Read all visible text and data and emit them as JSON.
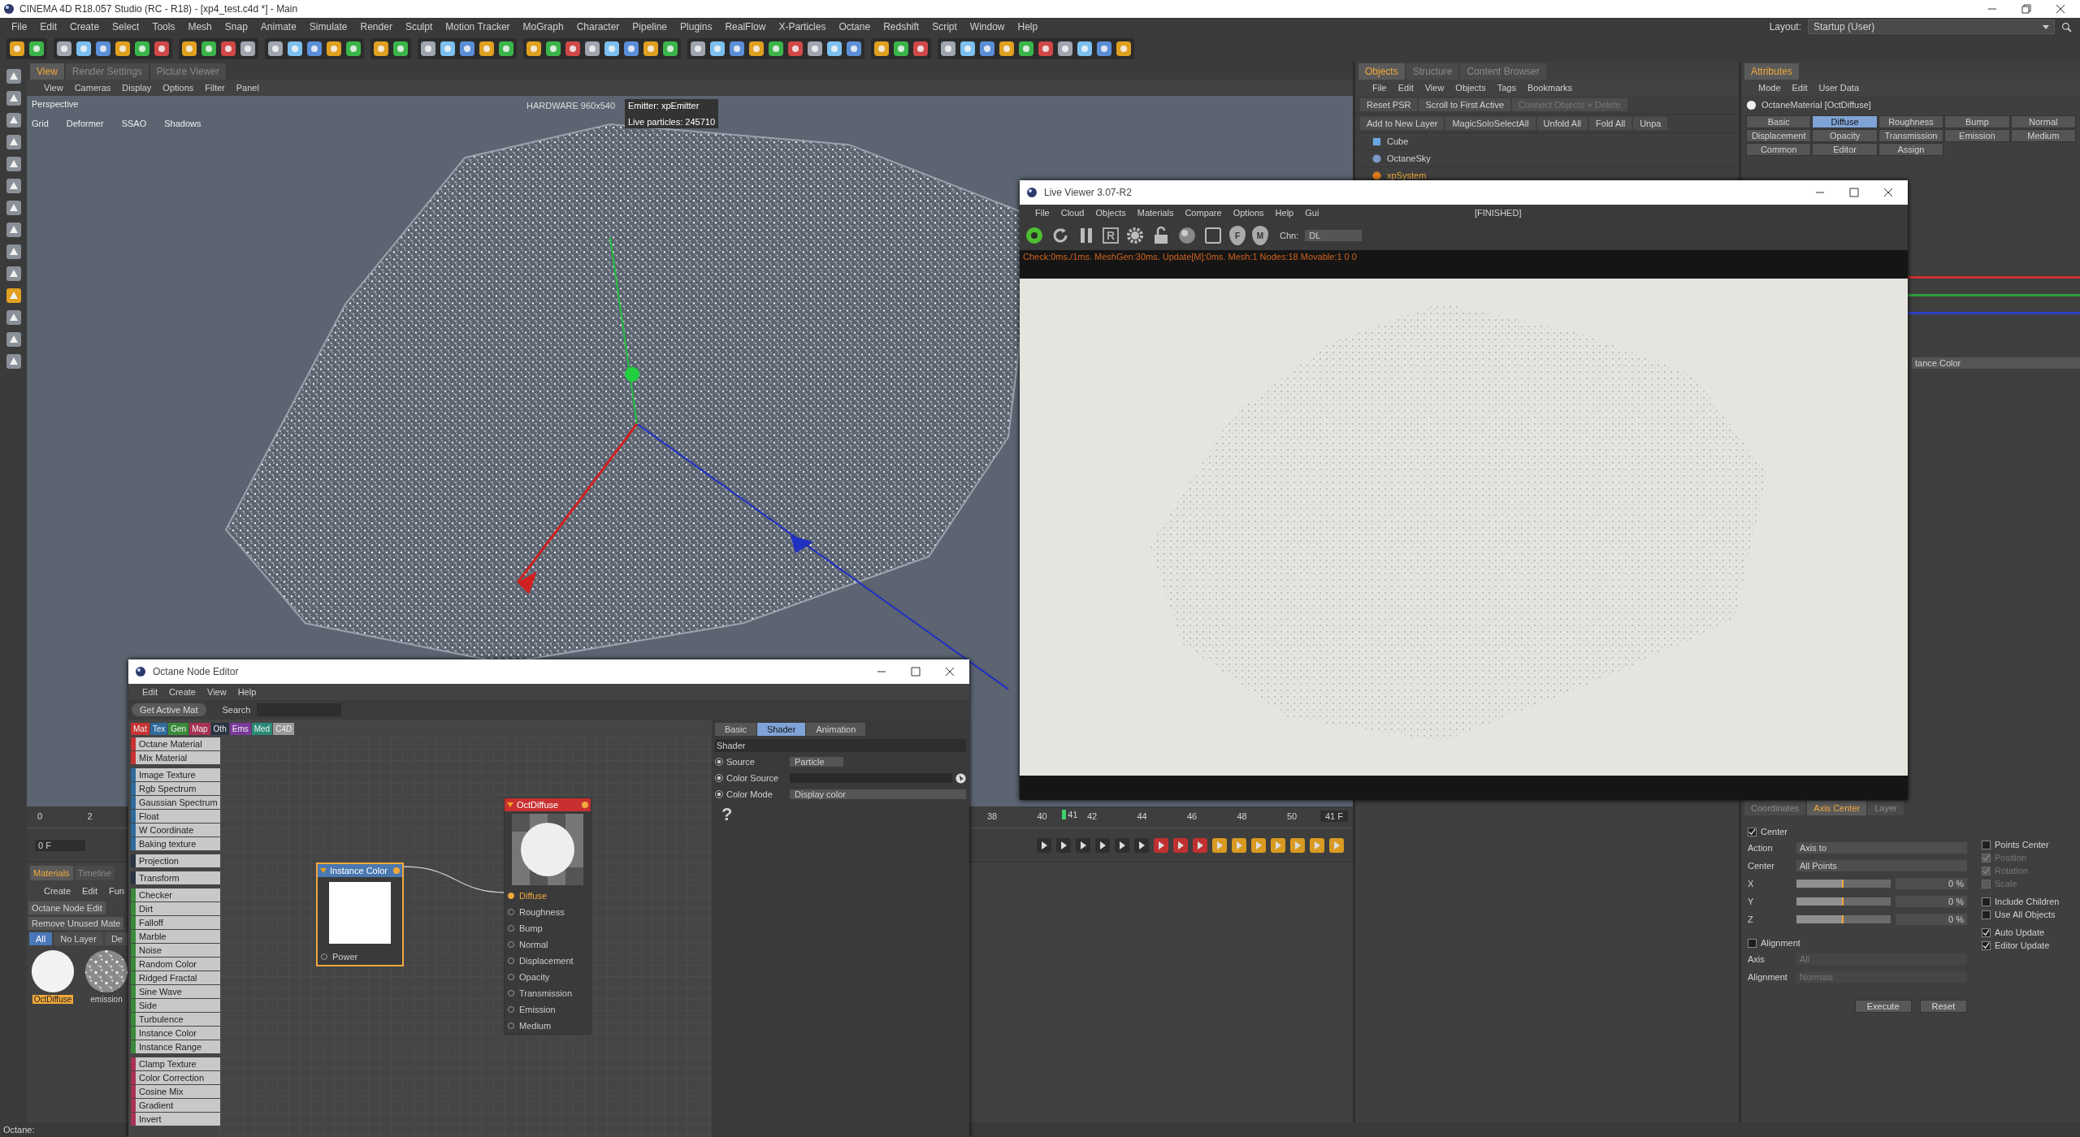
{
  "window": {
    "title": "CINEMA 4D R18.057 Studio (RC - R18) - [xp4_test.c4d *] - Main"
  },
  "menu": [
    "File",
    "Edit",
    "Create",
    "Select",
    "Tools",
    "Mesh",
    "Snap",
    "Animate",
    "Simulate",
    "Render",
    "Sculpt",
    "Motion Tracker",
    "MoGraph",
    "Character",
    "Pipeline",
    "Plugins",
    "RealFlow",
    "X-Particles",
    "Octane",
    "Redshift",
    "Script",
    "Window",
    "Help"
  ],
  "layout": {
    "label": "Layout:",
    "value": "Startup (User)"
  },
  "viewport": {
    "tabs": [
      {
        "label": "View",
        "selected": true
      },
      {
        "label": "Render Settings",
        "selected": false
      },
      {
        "label": "Picture Viewer",
        "selected": false
      }
    ],
    "menu": [
      "View",
      "Cameras",
      "Display",
      "Options",
      "Filter",
      "Panel"
    ],
    "camera": "Perspective",
    "overlays": [
      "Grid",
      "Deformer",
      "SSAO",
      "Shadows"
    ],
    "hud_left": "HARDWARE 960x540",
    "hud_right": [
      "Emitter: xpEmitter",
      "Live particles: 245710"
    ]
  },
  "timeline": {
    "ticks": [
      "0",
      "2",
      "38",
      "40",
      "42",
      "44",
      "46",
      "48",
      "50"
    ],
    "current": "41",
    "start_field": "0 F",
    "end_field": "41 F"
  },
  "materials": {
    "tabs": [
      {
        "label": "Materials",
        "selected": true
      },
      {
        "label": "Timeline",
        "selected": false
      }
    ],
    "menu": [
      "Create",
      "Edit",
      "Fun"
    ],
    "commands": [
      "Octane Node Edit",
      "Remove Unused Mate"
    ],
    "filters": [
      {
        "label": "All",
        "selected": true
      },
      {
        "label": "No Layer",
        "selected": false
      },
      {
        "label": "De",
        "selected": false
      }
    ],
    "swatches": [
      {
        "name": "OctDiffuse",
        "selected": true,
        "kind": "smooth"
      },
      {
        "name": "emission",
        "selected": false,
        "kind": "noisy"
      }
    ]
  },
  "objects": {
    "tabs": [
      {
        "label": "Objects",
        "selected": true
      },
      {
        "label": "Structure",
        "selected": false
      },
      {
        "label": "Content Browser",
        "selected": false
      }
    ],
    "menu": [
      "File",
      "Edit",
      "View",
      "Objects",
      "Tags",
      "Bookmarks"
    ],
    "toolbar1": [
      {
        "label": "Reset PSR",
        "disabled": false
      },
      {
        "label": "Scroll to First Active",
        "disabled": false
      },
      {
        "label": "Connect Objects + Delete",
        "disabled": true
      }
    ],
    "toolbar2": [
      "Add to New Layer",
      "MagicSoloSelectAll",
      "Unfold All",
      "Fold All",
      "Unpa"
    ],
    "tree": [
      {
        "name": "Cube",
        "kind": "cube",
        "selected": false
      },
      {
        "name": "OctaneSky",
        "kind": "sky",
        "selected": false
      },
      {
        "name": "xpSystem",
        "kind": "system",
        "selected": true
      }
    ]
  },
  "attributes": {
    "tab": "Attributes",
    "menu": [
      "Mode",
      "Edit",
      "User Data"
    ],
    "title": "OctaneMaterial [OctDiffuse]",
    "tabs": [
      {
        "label": "Basic",
        "selected": false
      },
      {
        "label": "Diffuse",
        "selected": true
      },
      {
        "label": "Roughness",
        "selected": false
      },
      {
        "label": "Bump",
        "selected": false
      },
      {
        "label": "Normal",
        "selected": false
      },
      {
        "label": "Displacement",
        "selected": false
      },
      {
        "label": "Opacity",
        "selected": false
      },
      {
        "label": "Transmission",
        "selected": false
      },
      {
        "label": "Emission",
        "selected": false
      },
      {
        "label": "Medium",
        "selected": false
      },
      {
        "label": "Common",
        "selected": false
      },
      {
        "label": "Editor",
        "selected": false
      },
      {
        "label": "Assign",
        "selected": false
      }
    ],
    "color_sliders": [
      {
        "color": "#c83232"
      },
      {
        "color": "#2fa040"
      },
      {
        "color": "#2f40c8"
      }
    ],
    "texture_label": "tance Color"
  },
  "axis_center": {
    "tabs": [
      {
        "label": "Coordinates",
        "selected": false
      },
      {
        "label": "Axis Center",
        "selected": true
      },
      {
        "label": "Layer",
        "selected": false
      }
    ],
    "center": {
      "label": "Center",
      "checked": true
    },
    "fields": [
      {
        "label": "Action",
        "value": "Axis to",
        "disabled": false
      },
      {
        "label": "Center",
        "value": "All Points",
        "disabled": false
      }
    ],
    "sliders": [
      {
        "label": "X",
        "level": 0.5,
        "value": "0 %"
      },
      {
        "label": "Y",
        "level": 0.5,
        "value": "0 %"
      },
      {
        "label": "Z",
        "level": 0.5,
        "value": "0 %"
      }
    ],
    "alignment": {
      "label": "Alignment",
      "checked": false
    },
    "align_fields": [
      {
        "label": "Axis",
        "value": "All",
        "disabled": true
      },
      {
        "label": "Alignment",
        "value": "Normals",
        "disabled": true
      }
    ],
    "option_groups": [
      [
        {
          "label": "Points Center",
          "checked": false,
          "disabled": false
        },
        {
          "label": "Position",
          "checked": true,
          "disabled": true
        },
        {
          "label": "Rotation",
          "checked": true,
          "disabled": true
        },
        {
          "label": "Scale",
          "checked": false,
          "disabled": true
        }
      ],
      [
        {
          "label": "Include Children",
          "checked": false,
          "disabled": false
        },
        {
          "label": "Use All Objects",
          "checked": false,
          "disabled": false
        }
      ],
      [
        {
          "label": "Auto Update",
          "checked": true,
          "disabled": false
        },
        {
          "label": "Editor Update",
          "checked": true,
          "disabled": false
        }
      ]
    ],
    "buttons": [
      "Execute",
      "Reset"
    ]
  },
  "live_viewer": {
    "title": "Live Viewer 3.07-R2",
    "menu": [
      "File",
      "Cloud",
      "Objects",
      "Materials",
      "Compare",
      "Options",
      "Help",
      "Gui"
    ],
    "state": "[FINISHED]",
    "tools": [
      {
        "kind": "logo"
      },
      {
        "kind": "refresh"
      },
      {
        "kind": "pause"
      },
      {
        "kind": "letter",
        "label": "R"
      },
      {
        "kind": "gear"
      },
      {
        "kind": "lock"
      },
      {
        "kind": "sphere"
      },
      {
        "kind": "crop"
      },
      {
        "kind": "pin",
        "label": "F"
      },
      {
        "kind": "pin",
        "label": "M"
      }
    ],
    "channel_label": "Chn:",
    "channel": "DL",
    "log": "Check:0ms./1ms. MeshGen:30ms. Update[M]:0ms. Mesh:1 Nodes:18 Movable:1  0 0"
  },
  "node_editor": {
    "title": "Octane Node Editor",
    "menu": [
      "Edit",
      "Create",
      "View",
      "Help"
    ],
    "button": "Get Active Mat",
    "search_label": "Search",
    "categories": [
      {
        "label": "Mat",
        "color": "#c83232"
      },
      {
        "label": "Tex",
        "color": "#2f6a9c"
      },
      {
        "label": "Gen",
        "color": "#3a8a3a"
      },
      {
        "label": "Map",
        "color": "#a83255"
      },
      {
        "label": "Oth",
        "color": "#2b3442"
      },
      {
        "label": "Ems",
        "color": "#7a3a9a"
      },
      {
        "label": "Med",
        "color": "#2a8a78"
      },
      {
        "label": "C4D",
        "color": "#9a9a9a"
      }
    ],
    "node_groups": [
      {
        "color": "#c83232",
        "items": [
          "Octane Material",
          "Mix Material"
        ]
      },
      {
        "color": "#2f6a9c",
        "items": [
          "Image Texture",
          "Rgb Spectrum",
          "Gaussian Spectrum",
          "Float",
          "W Coordinate",
          "Baking texture"
        ]
      },
      {
        "color": "#2b3442",
        "items": [
          "Projection"
        ]
      },
      {
        "color": "#2b3442",
        "items": [
          "Transform"
        ]
      },
      {
        "color": "#3a8a3a",
        "items": [
          "Checker",
          "Dirt",
          "Falloff",
          "Marble",
          "Noise",
          "Random Color",
          "Ridged Fractal",
          "Sine Wave",
          "Side",
          "Turbulence",
          "Instance Color",
          "Instance Range"
        ]
      },
      {
        "color": "#a83255",
        "items": [
          "Clamp Texture",
          "Color Correction",
          "Cosine Mix",
          "Gradient",
          "Invert"
        ]
      }
    ],
    "source_node": {
      "title": "Instance Color",
      "selected": true,
      "port": "Power"
    },
    "material_node": {
      "title": "OctDiffuse",
      "selected": false,
      "ports": [
        {
          "label": "Diffuse",
          "connected": true
        },
        {
          "label": "Roughness",
          "connected": false
        },
        {
          "label": "Bump",
          "connected": false
        },
        {
          "label": "Normal",
          "connected": false
        },
        {
          "label": "Displacement",
          "connected": false
        },
        {
          "label": "Opacity",
          "connected": false
        },
        {
          "label": "Transmission",
          "connected": false
        },
        {
          "label": "Emission",
          "connected": false
        },
        {
          "label": "Medium",
          "connected": false
        }
      ]
    },
    "panel": {
      "tabs": [
        {
          "label": "Basic",
          "selected": false
        },
        {
          "label": "Shader",
          "selected": true
        },
        {
          "label": "Animation",
          "selected": false
        }
      ],
      "header": "Shader",
      "rows": [
        {
          "label": "Source",
          "kind": "dropdown",
          "value": "Particle",
          "on": true
        },
        {
          "label": "Color Source",
          "kind": "link",
          "on": true
        },
        {
          "label": "Color Mode",
          "kind": "wide",
          "value": "Display color",
          "on": true
        }
      ],
      "help": "?"
    }
  },
  "status": "Octane:"
}
